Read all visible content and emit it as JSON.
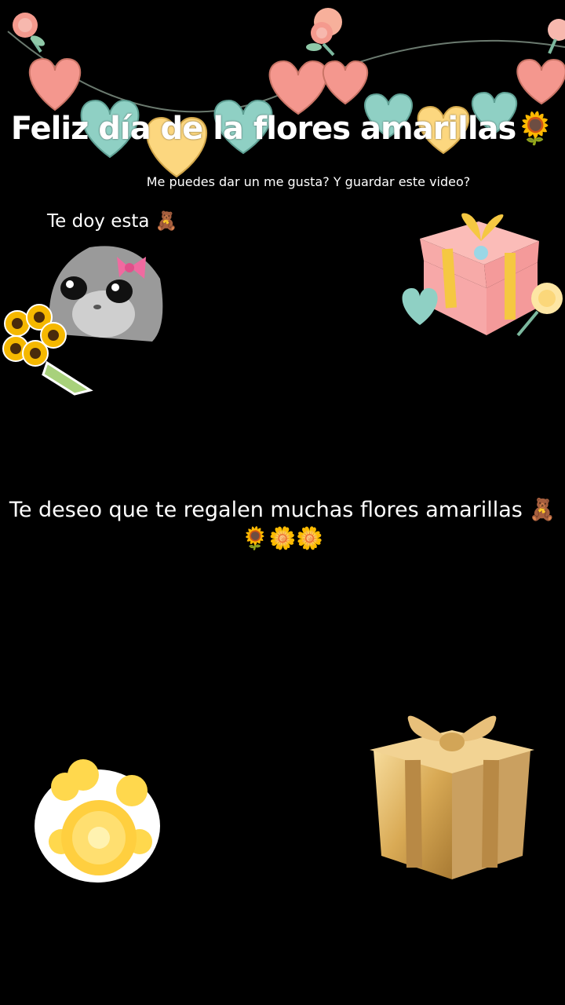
{
  "title": "Feliz día de la flores amarillas🌻",
  "subtitle": "Me puedes dar un me gusta? Y guardar este video?",
  "te_doy": "Te doy esta 🧸",
  "message_line1": "Te deseo que te regalen muchas flores amarillas 🧸",
  "message_line2": "🌻🌼🌼",
  "colors": {
    "background": "#000000",
    "heart_coral": "#f4978e",
    "heart_teal": "#8fd0c4",
    "heart_yellow": "#fcd77f",
    "gold": "#d9aa55",
    "gift_pink": "#f7a8a8",
    "gift_ribbon": "#f5c842",
    "flower_yellow": "#ffd84d"
  },
  "stickers": {
    "garland": "heart-garland",
    "hamster": "sad-hamster-with-bow",
    "bouquet": "sunflower-bouquet-icon",
    "pink_gift": "pink-gift-box",
    "yellow_flowers": "yellow-flower-bunch",
    "gold_gift": "golden-gift-box"
  }
}
